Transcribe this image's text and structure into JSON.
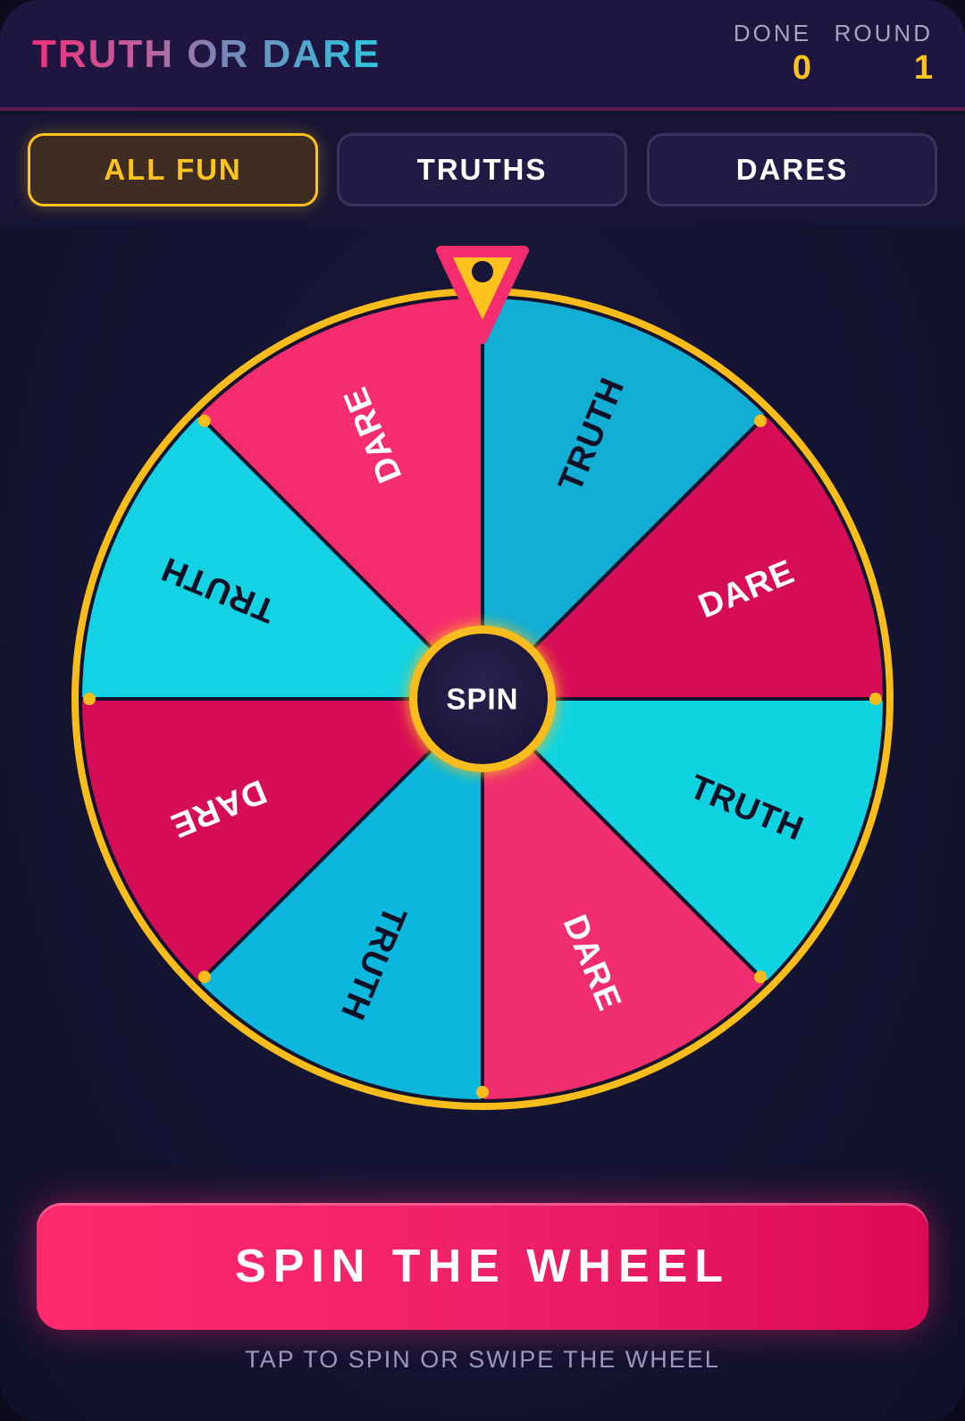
{
  "header": {
    "title": "TRUTH OR DARE",
    "done_label": "DONE",
    "done_value": "0",
    "round_label": "ROUND",
    "round_value": "1"
  },
  "filters": [
    {
      "label": "ALL FUN",
      "active": true
    },
    {
      "label": "TRUTHS",
      "active": false
    },
    {
      "label": "DARES",
      "active": false
    }
  ],
  "wheel": {
    "center_label": "SPIN",
    "segments": [
      {
        "label": "TRUTH",
        "color": "#12aed4"
      },
      {
        "label": "DARE",
        "color": "#d70c56"
      },
      {
        "label": "TRUTH",
        "color": "#10d3e2"
      },
      {
        "label": "DARE",
        "color": "#f02d6f"
      },
      {
        "label": "TRUTH",
        "color": "#0bb7dc"
      },
      {
        "label": "DARE",
        "color": "#d70c56"
      },
      {
        "label": "TRUTH",
        "color": "#12d2e4"
      },
      {
        "label": "DARE",
        "color": "#f52d6e"
      }
    ],
    "rim_color": "#f8bd1a",
    "pointer_icon": "pointer-triangle-icon"
  },
  "actions": {
    "spin_label": "SPIN THE WHEEL",
    "hint": "TAP TO SPIN OR SWIPE THE WHEEL"
  },
  "colors": {
    "accent": "#ffc31f",
    "pink": "#f0206a",
    "cyan": "#10d3e2"
  }
}
